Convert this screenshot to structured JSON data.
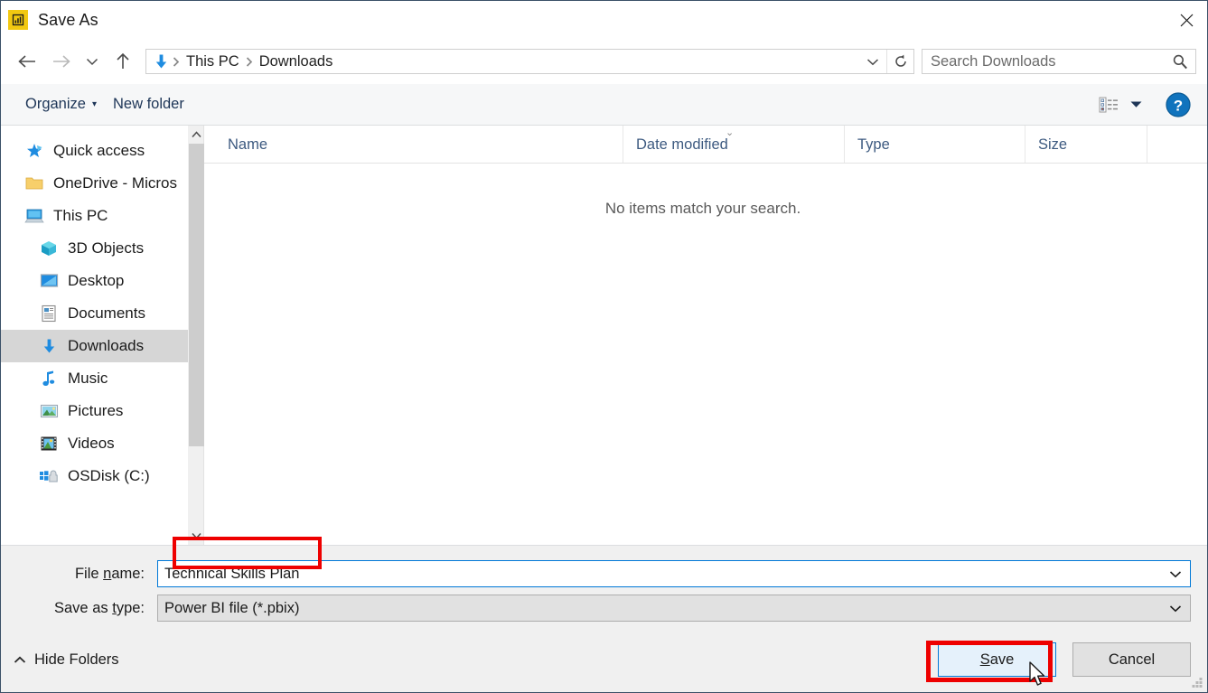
{
  "window": {
    "title": "Save As",
    "app_icon": "power-bi-icon",
    "close_label": "✕",
    "accent_blue": "#0078d7",
    "annotation_red": "#ee0000",
    "powerbi_yellow": "#f2c811"
  },
  "nav": {
    "back_label": "←",
    "forward_label": "→",
    "recent_label": "⌄",
    "up_label": "↑",
    "breadcrumb_icon": "downloads-arrow-icon",
    "breadcrumb": [
      "This PC",
      "Downloads"
    ],
    "separator": "❯",
    "dropdown_label": "⌄",
    "refresh_label": "↻"
  },
  "search": {
    "placeholder": "Search Downloads",
    "value": "",
    "icon": "search-icon"
  },
  "toolbar": {
    "organize_label": "Organize",
    "organize_caret": "▾",
    "new_folder_label": "New folder",
    "view_icon": "list-view-icon",
    "view_caret": "▾",
    "help_label": "?"
  },
  "sidebar": {
    "items": [
      {
        "label": "Quick access",
        "icon": "star-pin-icon",
        "indent": false,
        "selected": false
      },
      {
        "label": "OneDrive - Micros",
        "icon": "folder-icon",
        "indent": false,
        "selected": false
      },
      {
        "label": "This PC",
        "icon": "computer-icon",
        "indent": false,
        "selected": false
      },
      {
        "label": "3D Objects",
        "icon": "cube-icon",
        "indent": true,
        "selected": false
      },
      {
        "label": "Desktop",
        "icon": "monitor-icon",
        "indent": true,
        "selected": false
      },
      {
        "label": "Documents",
        "icon": "document-icon",
        "indent": true,
        "selected": false
      },
      {
        "label": "Downloads",
        "icon": "download-arrow-icon",
        "indent": true,
        "selected": true
      },
      {
        "label": "Music",
        "icon": "music-note-icon",
        "indent": true,
        "selected": false
      },
      {
        "label": "Pictures",
        "icon": "picture-icon",
        "indent": true,
        "selected": false
      },
      {
        "label": "Videos",
        "icon": "video-film-icon",
        "indent": true,
        "selected": false
      },
      {
        "label": "OSDisk (C:)",
        "icon": "disk-drive-icon",
        "indent": true,
        "selected": false
      }
    ],
    "scroll_up": "⌃",
    "scroll_down": "⌄"
  },
  "filelist": {
    "columns": [
      "Name",
      "Date modified",
      "Type",
      "Size"
    ],
    "sort_indicator": "⌄",
    "sort_column": "Date modified",
    "rows": [],
    "empty_message": "No items match your search."
  },
  "form": {
    "filename_label_pre": "File ",
    "filename_label_accel": "n",
    "filename_label_post": "ame:",
    "filename_value": "Technical Skills Plan",
    "filetype_label_pre": "Save as ",
    "filetype_label_accel": "t",
    "filetype_label_post": "ype:",
    "filetype_value": "Power BI file (*.pbix)",
    "dropdown_arrow": "⌄"
  },
  "footer": {
    "hide_folders_label": "Hide Folders",
    "hide_folders_caret": "⌃",
    "save_label_pre": "",
    "save_label_accel": "S",
    "save_label_post": "ave",
    "cancel_label": "Cancel"
  }
}
